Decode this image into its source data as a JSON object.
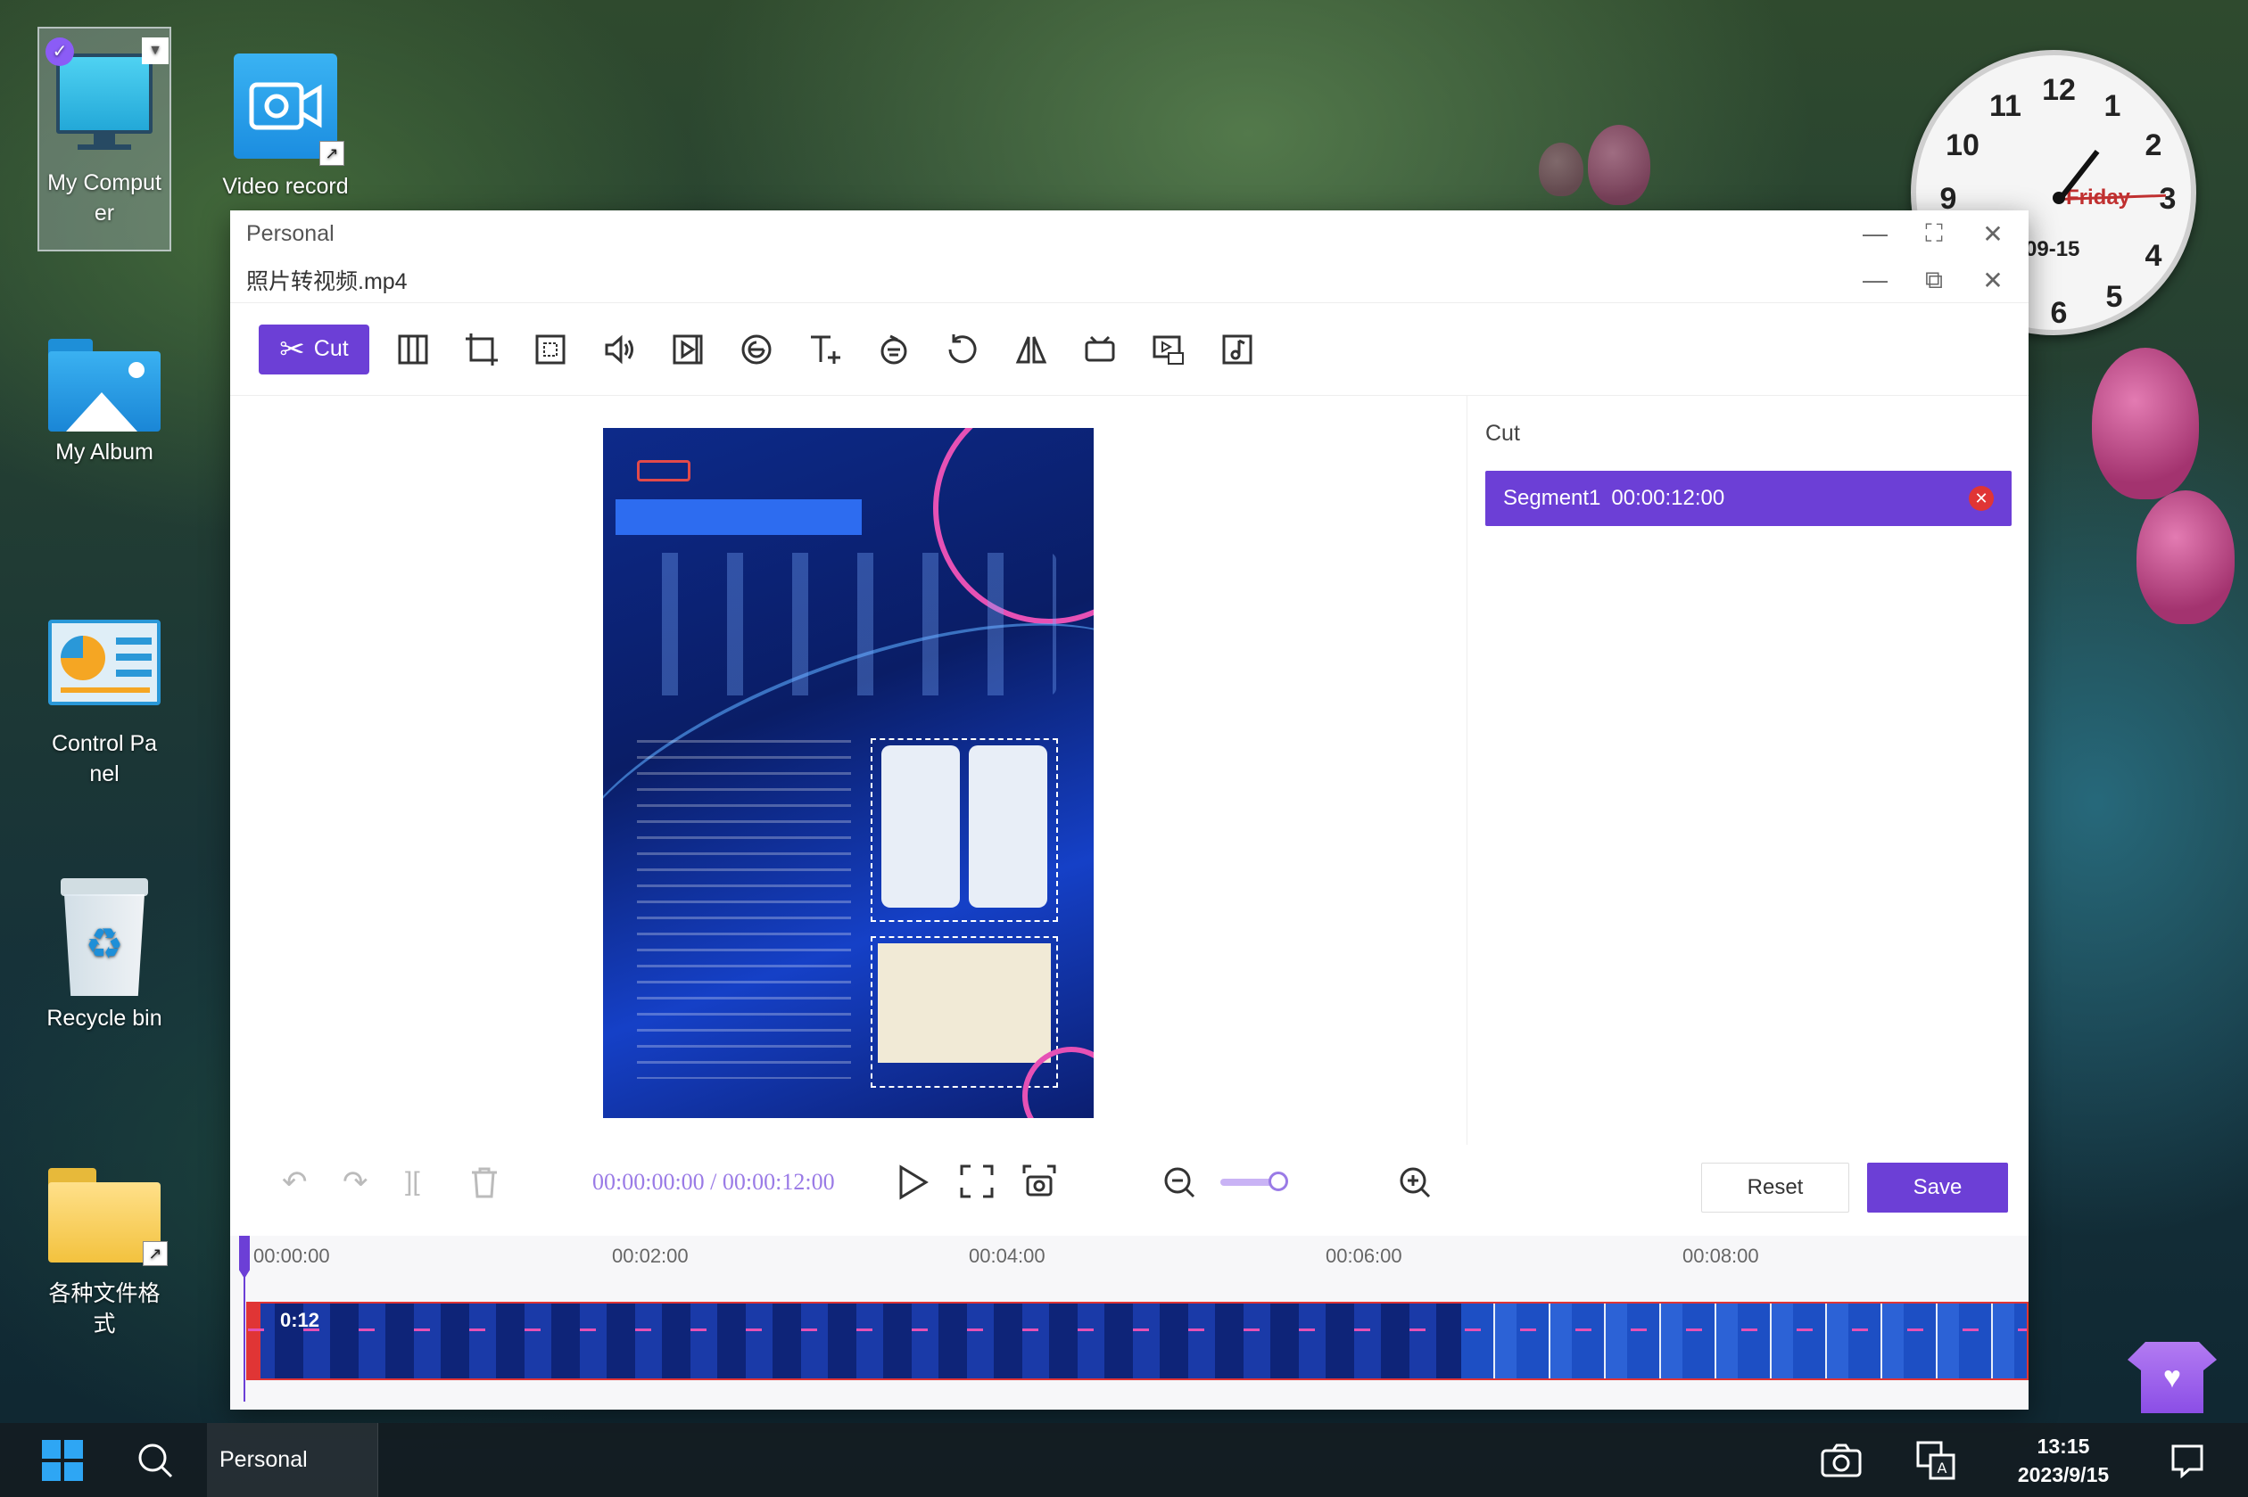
{
  "desktop": {
    "icons": [
      {
        "label": "My Computer"
      },
      {
        "label": "Video record"
      },
      {
        "label": "My Album"
      },
      {
        "label": "Control Panel"
      },
      {
        "label": "Recycle bin"
      },
      {
        "label": "各种文件格式"
      }
    ]
  },
  "clock": {
    "day": "Friday",
    "date": "09-15",
    "numbers": [
      "12",
      "1",
      "2",
      "3",
      "4",
      "5",
      "6",
      "9",
      "10",
      "11"
    ]
  },
  "window": {
    "title": "Personal",
    "file_name": "照片转视频.mp4",
    "toolbar": {
      "cut_label": "Cut"
    },
    "side": {
      "title": "Cut",
      "segment_label": "Segment1",
      "segment_time": "00:00:12:00",
      "reset_label": "Reset",
      "save_label": "Save"
    },
    "player": {
      "current": "00:00:00:00",
      "separator": " / ",
      "total": "00:00:12:00"
    },
    "timeline": {
      "ticks": [
        "00:00:00",
        "00:02:00",
        "00:04:00",
        "00:06:00",
        "00:08:00"
      ],
      "clip_duration": "0:12"
    }
  },
  "taskbar": {
    "app_label": "Personal",
    "time": "13:15",
    "date": "2023/9/15"
  }
}
